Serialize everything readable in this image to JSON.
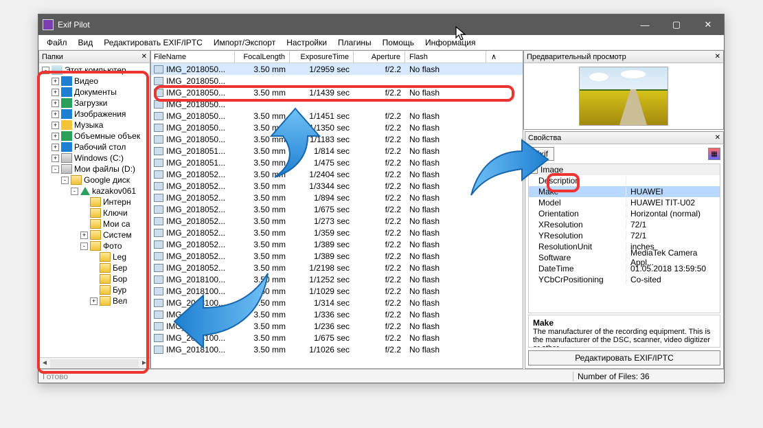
{
  "window": {
    "title": "Exif Pilot"
  },
  "menu": [
    "Файл",
    "Вид",
    "Редактировать EXIF/IPTC",
    "Импорт/Экспорт",
    "Настройки",
    "Плагины",
    "Помощь",
    "Информация"
  ],
  "panels": {
    "folders": "Папки",
    "preview": "Предварительный просмотр",
    "props": "Свойства"
  },
  "tree": [
    {
      "indent": 0,
      "exp": "-",
      "icon": "computer",
      "label": "Этот компьютер"
    },
    {
      "indent": 1,
      "exp": "+",
      "icon": "video",
      "label": "Видео"
    },
    {
      "indent": 1,
      "exp": "+",
      "icon": "doc",
      "label": "Документы"
    },
    {
      "indent": 1,
      "exp": "+",
      "icon": "down",
      "label": "Загрузки"
    },
    {
      "indent": 1,
      "exp": "+",
      "icon": "img",
      "label": "Изображения"
    },
    {
      "indent": 1,
      "exp": "+",
      "icon": "music",
      "label": "Музыка"
    },
    {
      "indent": 1,
      "exp": "+",
      "icon": "obj3d",
      "label": "Объемные объек"
    },
    {
      "indent": 1,
      "exp": "+",
      "icon": "desktop",
      "label": "Рабочий стол"
    },
    {
      "indent": 1,
      "exp": "+",
      "icon": "drive",
      "label": "Windows (C:)"
    },
    {
      "indent": 1,
      "exp": "-",
      "icon": "drive",
      "label": "Мои файлы (D:)"
    },
    {
      "indent": 2,
      "exp": "-",
      "icon": "folder",
      "label": "Google диск"
    },
    {
      "indent": 3,
      "exp": "-",
      "icon": "gdrive",
      "label": "kazakov061"
    },
    {
      "indent": 4,
      "exp": "",
      "icon": "folder",
      "label": "Интерн"
    },
    {
      "indent": 4,
      "exp": "",
      "icon": "folder",
      "label": "Ключи"
    },
    {
      "indent": 4,
      "exp": "",
      "icon": "folder",
      "label": "Мои са"
    },
    {
      "indent": 4,
      "exp": "+",
      "icon": "folder",
      "label": "Систем"
    },
    {
      "indent": 4,
      "exp": "-",
      "icon": "folder",
      "label": "Фото"
    },
    {
      "indent": 5,
      "exp": "",
      "icon": "folder",
      "label": "Leg"
    },
    {
      "indent": 5,
      "exp": "",
      "icon": "folder",
      "label": "Бер"
    },
    {
      "indent": 5,
      "exp": "",
      "icon": "folder",
      "label": "Бор"
    },
    {
      "indent": 5,
      "exp": "",
      "icon": "folder",
      "label": "Бур"
    },
    {
      "indent": 5,
      "exp": "+",
      "icon": "folder",
      "label": "Вел"
    }
  ],
  "cols": {
    "fname": "FileName",
    "focal": "FocalLength",
    "exp": "ExposureTime",
    "ap": "Aperture",
    "flash": "Flash"
  },
  "files": [
    {
      "name": "IMG_2018050...",
      "focal": "3.50 mm",
      "exp": "1/2959 sec",
      "ap": "f/2.2",
      "flash": "No flash",
      "sel": true
    },
    {
      "name": "IMG_2018050...",
      "focal": "",
      "exp": "",
      "ap": "",
      "flash": ""
    },
    {
      "name": "IMG_2018050...",
      "focal": "3.50 mm",
      "exp": "1/1439 sec",
      "ap": "f/2.2",
      "flash": "No flash"
    },
    {
      "name": "IMG_2018050...",
      "focal": "",
      "exp": "",
      "ap": "",
      "flash": ""
    },
    {
      "name": "IMG_2018050...",
      "focal": "3.50 mm",
      "exp": "1/1451 sec",
      "ap": "f/2.2",
      "flash": "No flash"
    },
    {
      "name": "IMG_2018050...",
      "focal": "3.50 mm",
      "exp": "1/1350 sec",
      "ap": "f/2.2",
      "flash": "No flash"
    },
    {
      "name": "IMG_2018050...",
      "focal": "3.50 mm",
      "exp": "1/1183 sec",
      "ap": "f/2.2",
      "flash": "No flash"
    },
    {
      "name": "IMG_2018051...",
      "focal": "3.50 mm",
      "exp": "1/814 sec",
      "ap": "f/2.2",
      "flash": "No flash"
    },
    {
      "name": "IMG_2018051...",
      "focal": "3.50 mm",
      "exp": "1/475 sec",
      "ap": "f/2.2",
      "flash": "No flash"
    },
    {
      "name": "IMG_2018052...",
      "focal": "3.50 mm",
      "exp": "1/2404 sec",
      "ap": "f/2.2",
      "flash": "No flash"
    },
    {
      "name": "IMG_2018052...",
      "focal": "3.50 mm",
      "exp": "1/3344 sec",
      "ap": "f/2.2",
      "flash": "No flash"
    },
    {
      "name": "IMG_2018052...",
      "focal": "3.50 mm",
      "exp": "1/894 sec",
      "ap": "f/2.2",
      "flash": "No flash"
    },
    {
      "name": "IMG_2018052...",
      "focal": "3.50 mm",
      "exp": "1/675 sec",
      "ap": "f/2.2",
      "flash": "No flash"
    },
    {
      "name": "IMG_2018052...",
      "focal": "3.50 mm",
      "exp": "1/273 sec",
      "ap": "f/2.2",
      "flash": "No flash"
    },
    {
      "name": "IMG_2018052...",
      "focal": "3.50 mm",
      "exp": "1/359 sec",
      "ap": "f/2.2",
      "flash": "No flash"
    },
    {
      "name": "IMG_2018052...",
      "focal": "3.50 mm",
      "exp": "1/389 sec",
      "ap": "f/2.2",
      "flash": "No flash"
    },
    {
      "name": "IMG_2018052...",
      "focal": "3.50 mm",
      "exp": "1/389 sec",
      "ap": "f/2.2",
      "flash": "No flash"
    },
    {
      "name": "IMG_2018052...",
      "focal": "3.50 mm",
      "exp": "1/2198 sec",
      "ap": "f/2.2",
      "flash": "No flash"
    },
    {
      "name": "IMG_2018100...",
      "focal": "3.50 mm",
      "exp": "1/1252 sec",
      "ap": "f/2.2",
      "flash": "No flash"
    },
    {
      "name": "IMG_2018100...",
      "focal": "3.50 mm",
      "exp": "1/1029 sec",
      "ap": "f/2.2",
      "flash": "No flash"
    },
    {
      "name": "IMG_2018100...",
      "focal": "3.50 mm",
      "exp": "1/314 sec",
      "ap": "f/2.2",
      "flash": "No flash"
    },
    {
      "name": "IMG_2018100...",
      "focal": "3.50 mm",
      "exp": "1/336 sec",
      "ap": "f/2.2",
      "flash": "No flash"
    },
    {
      "name": "IMG_2018100...",
      "focal": "3.50 mm",
      "exp": "1/236 sec",
      "ap": "f/2.2",
      "flash": "No flash"
    },
    {
      "name": "IMG_2018100...",
      "focal": "3.50 mm",
      "exp": "1/675 sec",
      "ap": "f/2.2",
      "flash": "No flash"
    },
    {
      "name": "IMG_2018100...",
      "focal": "3.50 mm",
      "exp": "1/1026 sec",
      "ap": "f/2.2",
      "flash": "No flash"
    }
  ],
  "propsTab": "Exif",
  "propGroup": "Image",
  "props": [
    {
      "k": "Description",
      "v": ""
    },
    {
      "k": "Make",
      "v": "HUAWEI",
      "sel": true
    },
    {
      "k": "Model",
      "v": "HUAWEI TIT-U02"
    },
    {
      "k": "Orientation",
      "v": "Horizontal (normal)"
    },
    {
      "k": "XResolution",
      "v": "72/1"
    },
    {
      "k": "YResolution",
      "v": "72/1"
    },
    {
      "k": "ResolutionUnit",
      "v": "inches"
    },
    {
      "k": "Software",
      "v": "MediaTek Camera Appl..."
    },
    {
      "k": "DateTime",
      "v": "01.05.2018 13:59:50"
    },
    {
      "k": "YCbCrPositioning",
      "v": "Co-sited"
    }
  ],
  "propDesc": {
    "title": "Make",
    "text": "The manufacturer of the recording equipment. This is the manufacturer of the DSC, scanner, video digitizer or other"
  },
  "editBtn": "Редактировать EXIF/IPTC",
  "status": {
    "left": "Готово",
    "right": "Number of Files: 36"
  }
}
